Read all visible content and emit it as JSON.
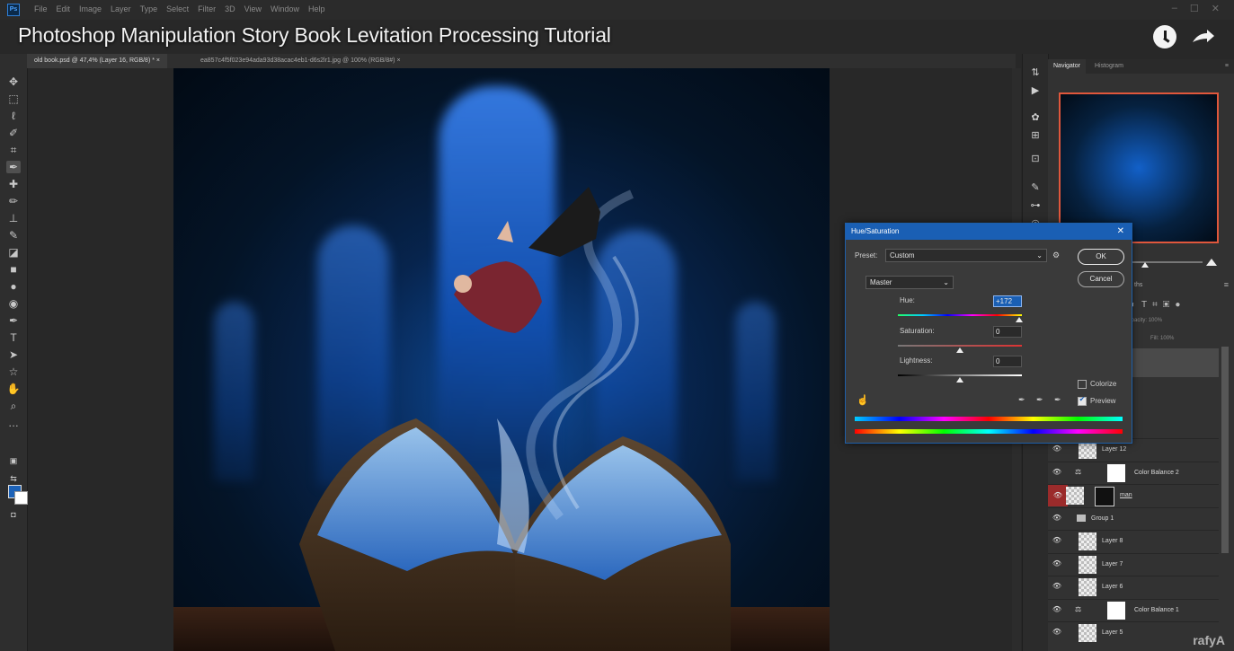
{
  "app": {
    "logo_text": "Ps",
    "menu": [
      "File",
      "Edit",
      "Image",
      "Layer",
      "Type",
      "Select",
      "Filter",
      "3D",
      "View",
      "Window",
      "Help"
    ],
    "window_controls": [
      "–",
      "☐",
      "✕"
    ]
  },
  "video": {
    "title": "Photoshop Manipulation Story Book Levitation Processing Tutorial",
    "watermark": "rafyA"
  },
  "tabs": [
    {
      "label": "old book.psd @ 47,4% (Layer 16, RGB/8) *",
      "close": "×"
    },
    {
      "label": "ea857c4f5f023e94ada93d38acac4eb1-d6s2lr1.jpg @ 100% (RGB/8#)",
      "close": "×"
    }
  ],
  "tools": [
    "move-tool",
    "marquee-tool",
    "lasso-tool",
    "quick-select-tool",
    "crop-tool",
    "eyedropper-tool",
    "healing-tool",
    "brush-tool",
    "clone-stamp-tool",
    "history-brush-tool",
    "eraser-tool",
    "gradient-tool",
    "blur-tool",
    "dodge-tool",
    "pen-tool",
    "type-tool",
    "path-select-tool",
    "shape-tool",
    "hand-tool",
    "zoom-tool",
    "more-tools"
  ],
  "colors": {
    "foreground": "#1c62b8",
    "background": "#ffffff",
    "dialog_title": "#1a5fb4"
  },
  "navigator": {
    "tabs": [
      "Navigator",
      "Histogram"
    ]
  },
  "hue_saturation": {
    "title": "Hue/Saturation",
    "close": "✕",
    "preset_label": "Preset:",
    "preset_value": "Custom",
    "channel": "Master",
    "hue_label": "Hue:",
    "hue_value": "+172",
    "saturation_label": "Saturation:",
    "saturation_value": "0",
    "lightness_label": "Lightness:",
    "lightness_value": "0",
    "ok_label": "OK",
    "cancel_label": "Cancel",
    "colorize_label": "Colorize",
    "colorize_checked": false,
    "preview_label": "Preview",
    "preview_checked": true,
    "hue_knob_fraction": 0.98,
    "saturation_knob_fraction": 0.5,
    "lightness_knob_fraction": 0.5
  },
  "layers_panel": {
    "tab_suffix": "ths",
    "opacity_label": "Opacity:",
    "opacity_value": "100%",
    "fill_label": "Fill:",
    "fill_value": "100%",
    "layers": [
      {
        "name": "Layer 12",
        "type": "pixel"
      },
      {
        "name": "Color Balance 2",
        "type": "adjustment"
      },
      {
        "name": "man",
        "type": "pixel-mask",
        "selected": true
      },
      {
        "name": "Group 1",
        "type": "group"
      },
      {
        "name": "Layer 8",
        "type": "pixel"
      },
      {
        "name": "Layer 7",
        "type": "pixel"
      },
      {
        "name": "Layer 6",
        "type": "pixel"
      },
      {
        "name": "Color Balance 1",
        "type": "adjustment"
      },
      {
        "name": "Layer 5",
        "type": "pixel"
      }
    ]
  }
}
